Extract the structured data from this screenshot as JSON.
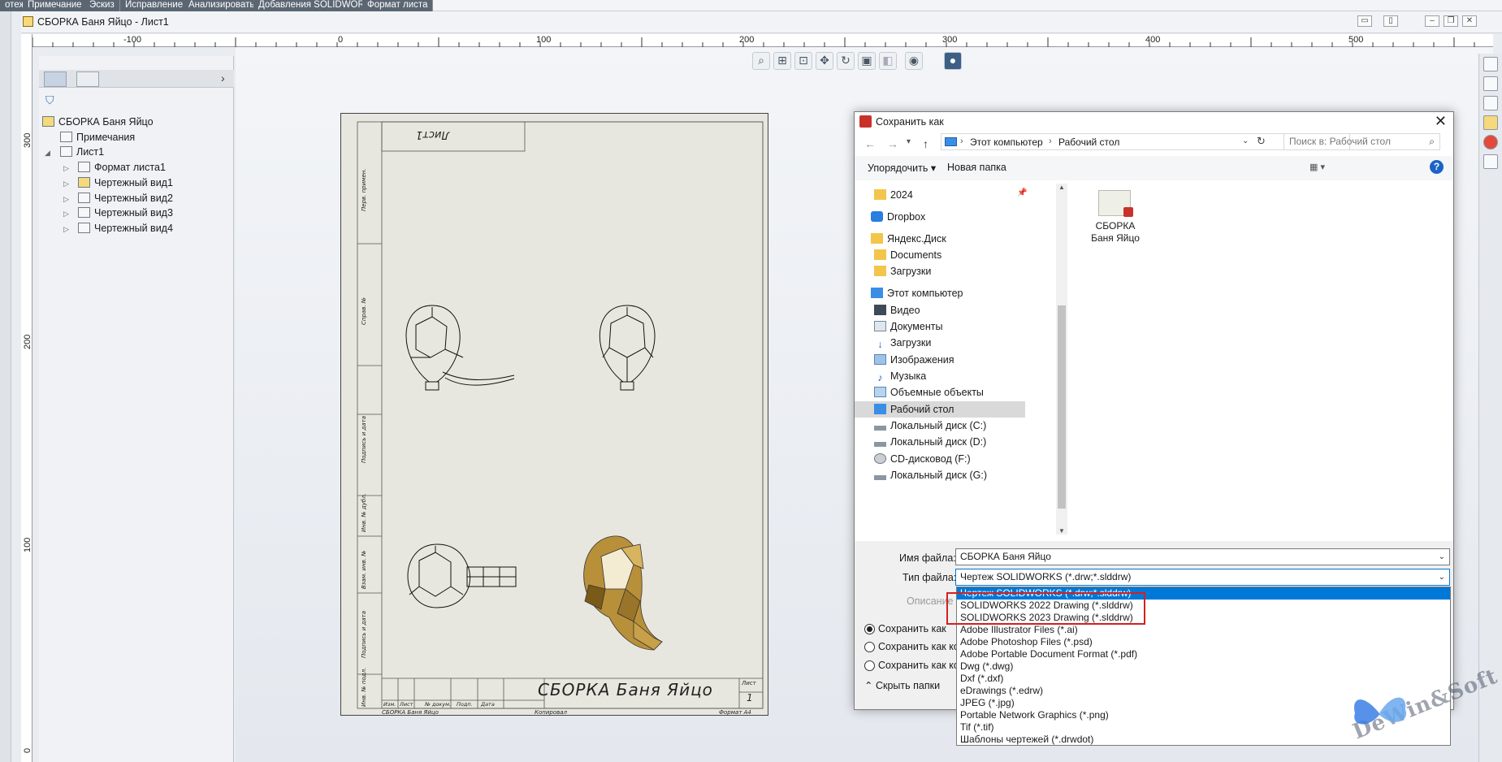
{
  "tabs": [
    "отеж",
    "Примечание",
    "Эскиз",
    "Исправление",
    "Анализировать",
    "Добавления SOLIDWORKS",
    "Формат листа"
  ],
  "doc": {
    "title": "СБОРКА Баня Яйцо - Лист1"
  },
  "ruler": {
    "h_ticks": [
      "-100",
      "0",
      "100",
      "200",
      "300",
      "400",
      "500"
    ],
    "v_ticks": [
      "300",
      "200",
      "100",
      "0"
    ]
  },
  "tree": {
    "root": "СБОРКА Баня Яйцо",
    "notes": "Примечания",
    "sheet": "Лист1",
    "format": "Формат листа1",
    "views": [
      "Чертежный вид1",
      "Чертежный вид2",
      "Чертежный вид3",
      "Чертежный вид4"
    ]
  },
  "sheet": {
    "top_label": "Лист1",
    "title": "СБОРКА Баня Яйцо",
    "sheet_label": "Лист",
    "sheet_num": "1",
    "bottom_name": "СБОРКА Баня Яйцо",
    "copied": "Копировал",
    "format": "Формат А4",
    "side_labels": [
      "Перв. примен.",
      "Справ. №",
      "Подпись и дата",
      "Инв. № дубл.",
      "Взам. инв. №",
      "Подпись и дата",
      "Инв. № подл."
    ],
    "small_cols": [
      "Изм.",
      "Лист",
      "№ докум.",
      "Подп.",
      "Дата"
    ]
  },
  "dialog": {
    "title": "Сохранить как",
    "path": [
      "Этот компьютер",
      "Рабочий стол"
    ],
    "search_placeholder": "Поиск в: Рабочий стол",
    "organize": "Упорядочить",
    "new_folder": "Новая папка",
    "nav": [
      "2024",
      "Dropbox",
      "Яндекс.Диск",
      "Documents",
      "Загрузки",
      "Этот компьютер",
      "Видео",
      "Документы",
      "Загрузки",
      "Изображения",
      "Музыка",
      "Объемные объекты",
      "Рабочий стол",
      "Локальный диск (C:)",
      "Локальный диск (D:)",
      "CD-дисковод (F:)",
      "Локальный диск (G:)"
    ],
    "file_item": [
      "СБОРКА",
      "Баня Яйцо"
    ],
    "filename_label": "Имя файла:",
    "filename": "СБОРКА Баня Яйцо",
    "filetype_label": "Тип файла:",
    "filetype": "Чертеж SOLIDWORKS (*.drw;*.slddrw)",
    "desc_label": "Описание",
    "save_as": [
      "Сохранить как",
      "Сохранить как ко",
      "Сохранить как ко"
    ],
    "hide_folders": "Скрыть папки",
    "types": [
      "Чертеж SOLIDWORKS (*.drw;*.slddrw)",
      "SOLIDWORKS 2022 Drawing (*.slddrw)",
      "SOLIDWORKS 2023 Drawing (*.slddrw)",
      "Adobe Illustrator Files (*.ai)",
      "Adobe Photoshop Files (*.psd)",
      "Adobe Portable Document Format (*.pdf)",
      "Dwg (*.dwg)",
      "Dxf (*.dxf)",
      "eDrawings (*.edrw)",
      "JPEG (*.jpg)",
      "Portable Network Graphics (*.png)",
      "Tif (*.tif)",
      "Шаблоны чертежей (*.drwdot)"
    ]
  },
  "watermark": "DeWin&Soft",
  "colors": {
    "accent": "#0078d7",
    "highlight": "#d42020",
    "tab_bg": "#5b6673"
  }
}
